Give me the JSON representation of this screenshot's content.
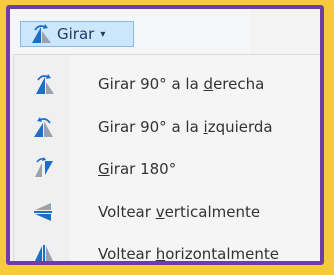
{
  "colors": {
    "background": "#f7ca3e",
    "frame_border": "#6d3fa3",
    "button_fill": "#cde6fa",
    "button_border": "#86b9e6",
    "icon_blue": "#1c6fc4",
    "icon_gray": "#9aa3ad"
  },
  "toolbar": {
    "rotate_button": {
      "label": "Girar",
      "icon": "rotate-right-icon",
      "caret": "▾"
    }
  },
  "menu": {
    "items": [
      {
        "pre": "Girar 90° a la ",
        "key": "d",
        "post": "erecha",
        "icon": "rotate-right-90-icon"
      },
      {
        "pre": "Girar 90° a la ",
        "key": "i",
        "post": "zquierda",
        "icon": "rotate-left-90-icon"
      },
      {
        "pre": "",
        "key": "G",
        "post": "irar 180°",
        "icon": "rotate-180-icon"
      },
      {
        "pre": "Voltear ",
        "key": "v",
        "post": "erticalmente",
        "icon": "flip-vertical-icon"
      },
      {
        "pre": "Voltear ",
        "key": "h",
        "post": "orizontalmente",
        "icon": "flip-horizontal-icon"
      }
    ]
  }
}
